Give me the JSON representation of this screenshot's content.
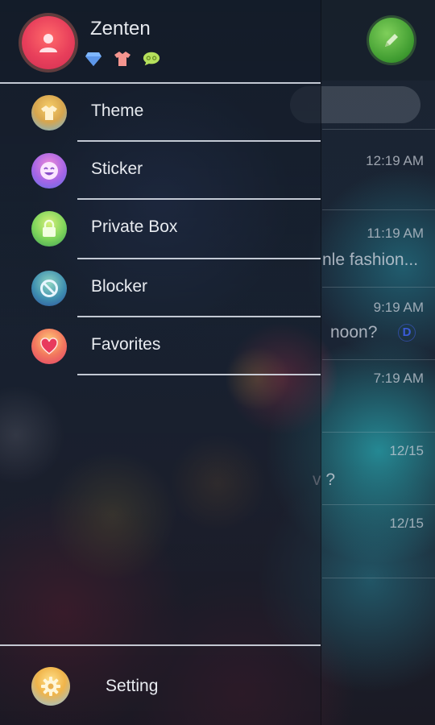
{
  "profile": {
    "username": "Zenten",
    "badges": [
      {
        "icon": "diamond-icon",
        "color": "#7fb7ff"
      },
      {
        "icon": "shirt-icon",
        "color": "#f4958f"
      },
      {
        "icon": "chat-bubble-icon",
        "color": "#b5e05c"
      }
    ]
  },
  "menu": [
    {
      "label": "Theme",
      "icon": "theme-shirt-icon"
    },
    {
      "label": "Sticker",
      "icon": "smiley-icon"
    },
    {
      "label": "Private Box",
      "icon": "lock-icon"
    },
    {
      "label": "Blocker",
      "icon": "block-icon"
    },
    {
      "label": "Favorites",
      "icon": "heart-icon"
    }
  ],
  "settings": {
    "label": "Setting",
    "icon": "gear-icon"
  },
  "chat_list": {
    "rows": [
      {
        "time": "12:19 AM",
        "preview": ""
      },
      {
        "time": "11:19 AM",
        "preview": "nle fashion..."
      },
      {
        "time": "9:19 AM",
        "preview": "noon?"
      },
      {
        "time": "7:19 AM",
        "preview": ""
      },
      {
        "time": "12/15",
        "preview": "v ?"
      },
      {
        "time": "12/15",
        "preview": ""
      }
    ],
    "badge": "D"
  },
  "colors": {
    "avatar": "#e83f5b",
    "compose": "#3d9a2f",
    "divider": "#e1e6f0"
  }
}
